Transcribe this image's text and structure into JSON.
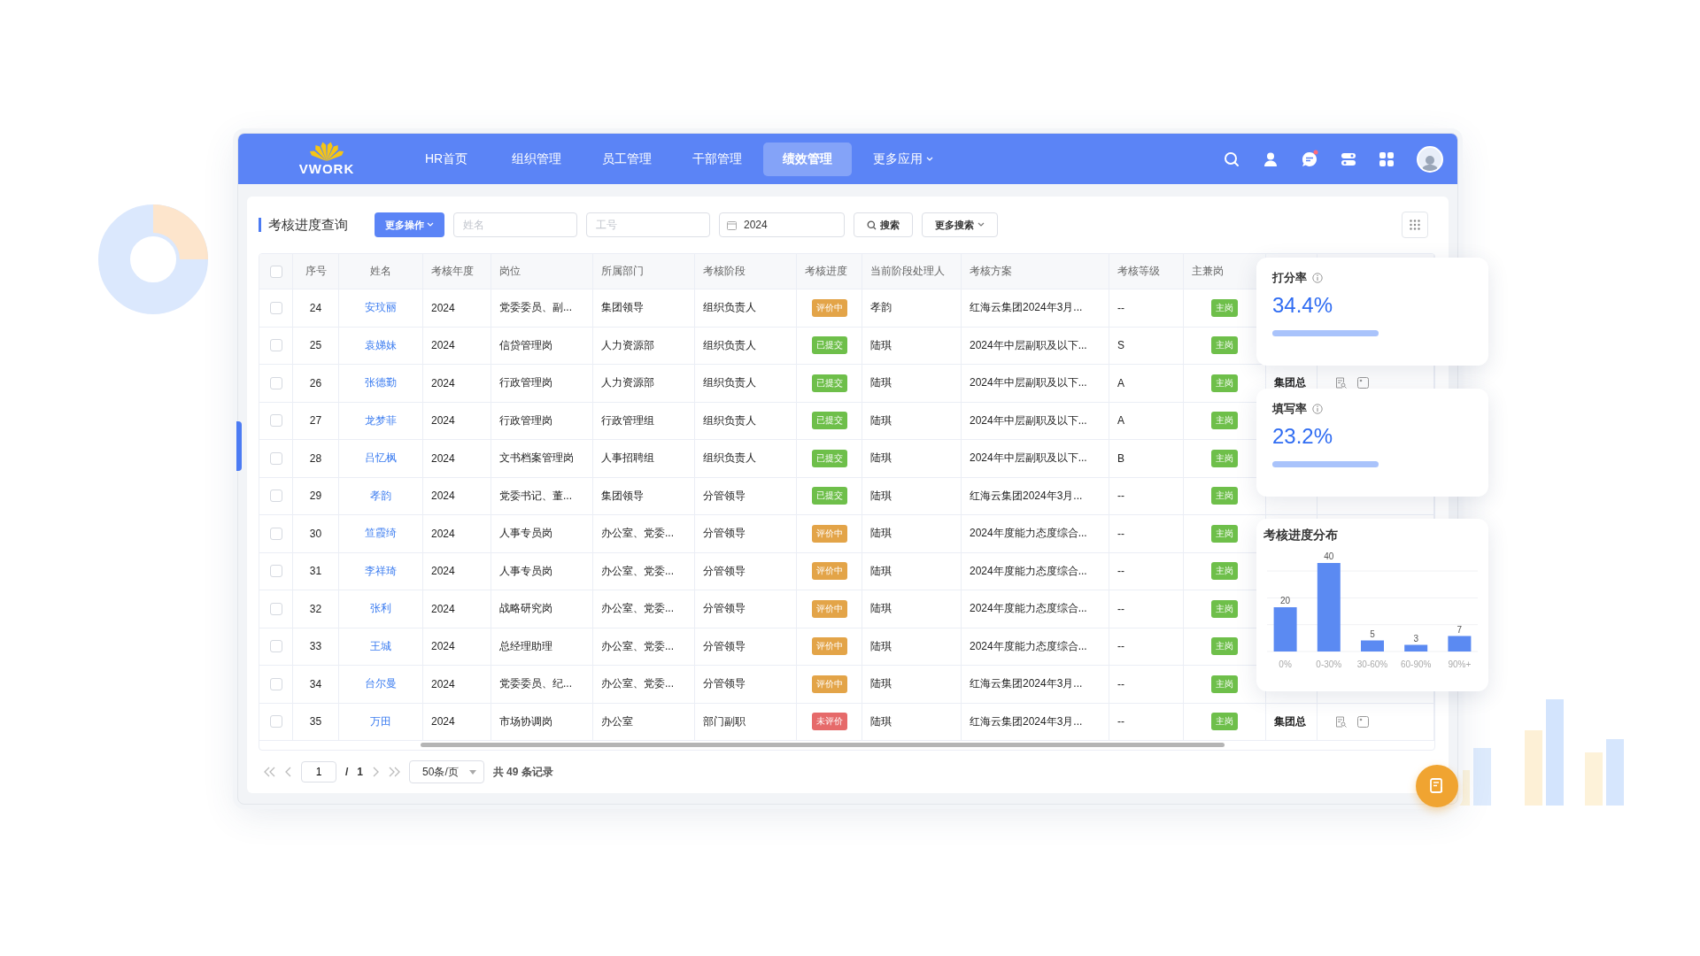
{
  "nav": {
    "logo": "VWORK",
    "items": [
      {
        "label": "HR首页",
        "selected": false
      },
      {
        "label": "组织管理",
        "selected": false
      },
      {
        "label": "员工管理",
        "selected": false
      },
      {
        "label": "干部管理",
        "selected": false
      },
      {
        "label": "绩效管理",
        "selected": true
      },
      {
        "label": "更多应用",
        "selected": false,
        "dropdown": true
      }
    ],
    "chat_unread": true
  },
  "toolbar": {
    "title": "考核进度查询",
    "more_actions": "更多操作",
    "name_field": {
      "placeholder": "姓名"
    },
    "id_field": {
      "placeholder": "工号"
    },
    "year_field": {
      "value": "2024"
    },
    "search": "搜索",
    "more_search": "更多搜索"
  },
  "table": {
    "header_checked": false,
    "columns": [
      "序号",
      "姓名",
      "考核年度",
      "岗位",
      "所属部门",
      "考核阶段",
      "考核进度",
      "当前阶段处理人",
      "考核方案",
      "考核等级",
      "主兼岗"
    ],
    "rows": [
      {
        "checked": false,
        "no": "24",
        "name": "安玟丽",
        "year": "2024",
        "post": "党委委员、副...",
        "dept": "集团领导",
        "stage": "组织负责人",
        "progress": {
          "text": "评价中",
          "color": "#e3a448"
        },
        "handler": "孝韵",
        "plan": "红海云集团2024年3月...",
        "grade": "--",
        "post_type": "主岗"
      },
      {
        "checked": false,
        "no": "25",
        "name": "袁娣妹",
        "year": "2024",
        "post": "信贷管理岗",
        "dept": "人力资源部",
        "stage": "组织负责人",
        "progress": {
          "text": "已提交",
          "color": "#6ebf4a"
        },
        "handler": "陆琪",
        "plan": "2024年中层副职及以下...",
        "grade": "S",
        "post_type": "主岗"
      },
      {
        "checked": false,
        "no": "26",
        "name": "张德勤",
        "year": "2024",
        "post": "行政管理岗",
        "dept": "人力资源部",
        "stage": "组织负责人",
        "progress": {
          "text": "已提交",
          "color": "#6ebf4a"
        },
        "handler": "陆琪",
        "plan": "2024年中层副职及以下...",
        "grade": "A",
        "post_type": "主岗",
        "column_12": "集团总"
      },
      {
        "checked": false,
        "no": "27",
        "name": "龙梦菲",
        "year": "2024",
        "post": "行政管理岗",
        "dept": "行政管理组",
        "stage": "组织负责人",
        "progress": {
          "text": "已提交",
          "color": "#6ebf4a"
        },
        "handler": "陆琪",
        "plan": "2024年中层副职及以下...",
        "grade": "A",
        "post_type": "主岗"
      },
      {
        "checked": false,
        "no": "28",
        "name": "吕忆枫",
        "year": "2024",
        "post": "文书档案管理岗",
        "dept": "人事招聘组",
        "stage": "组织负责人",
        "progress": {
          "text": "已提交",
          "color": "#6ebf4a"
        },
        "handler": "陆琪",
        "plan": "2024年中层副职及以下...",
        "grade": "B",
        "post_type": "主岗"
      },
      {
        "checked": false,
        "no": "29",
        "name": "孝韵",
        "year": "2024",
        "post": "党委书记、董...",
        "dept": "集团领导",
        "stage": "分管领导",
        "progress": {
          "text": "已提交",
          "color": "#6ebf4a"
        },
        "handler": "陆琪",
        "plan": "红海云集团2024年3月...",
        "grade": "--",
        "post_type": "主岗"
      },
      {
        "checked": false,
        "no": "30",
        "name": "笪霞绮",
        "year": "2024",
        "post": "人事专员岗",
        "dept": "办公室、党委...",
        "stage": "分管领导",
        "progress": {
          "text": "评价中",
          "color": "#e3a448"
        },
        "handler": "陆琪",
        "plan": "2024年度能力态度综合...",
        "grade": "--",
        "post_type": "主岗"
      },
      {
        "checked": false,
        "no": "31",
        "name": "李祥琦",
        "year": "2024",
        "post": "人事专员岗",
        "dept": "办公室、党委...",
        "stage": "分管领导",
        "progress": {
          "text": "评价中",
          "color": "#e3a448"
        },
        "handler": "陆琪",
        "plan": "2024年度能力态度综合...",
        "grade": "--",
        "post_type": "主岗"
      },
      {
        "checked": false,
        "no": "32",
        "name": "张利",
        "year": "2024",
        "post": "战略研究岗",
        "dept": "办公室、党委...",
        "stage": "分管领导",
        "progress": {
          "text": "评价中",
          "color": "#e3a448"
        },
        "handler": "陆琪",
        "plan": "2024年度能力态度综合...",
        "grade": "--",
        "post_type": "主岗"
      },
      {
        "checked": false,
        "no": "33",
        "name": "王城",
        "year": "2024",
        "post": "总经理助理",
        "dept": "办公室、党委...",
        "stage": "分管领导",
        "progress": {
          "text": "评价中",
          "color": "#e3a448"
        },
        "handler": "陆琪",
        "plan": "2024年度能力态度综合...",
        "grade": "--",
        "post_type": "主岗"
      },
      {
        "checked": false,
        "no": "34",
        "name": "台尔曼",
        "year": "2024",
        "post": "党委委员、纪...",
        "dept": "办公室、党委...",
        "stage": "分管领导",
        "progress": {
          "text": "评价中",
          "color": "#e3a448"
        },
        "handler": "陆琪",
        "plan": "红海云集团2024年3月...",
        "grade": "--",
        "post_type": "主岗"
      },
      {
        "checked": false,
        "no": "35",
        "name": "万田",
        "year": "2024",
        "post": "市场协调岗",
        "dept": "办公室",
        "stage": "部门副职",
        "progress": {
          "text": "未评价",
          "color": "#e66a6a"
        },
        "handler": "陆琪",
        "plan": "红海云集团2024年3月...",
        "grade": "--",
        "post_type": "主岗",
        "column_12": "集团总"
      }
    ]
  },
  "pagination": {
    "page": "1",
    "separator": "/",
    "total_pages": "1",
    "page_size": "50条/页",
    "total": "共 49 条记录"
  },
  "stats": [
    {
      "label": "打分率",
      "value": "34.4%"
    },
    {
      "label": "填写率",
      "value": "23.2%"
    }
  ],
  "distribution": {
    "title": "考核进度分布",
    "chart_data": {
      "type": "bar",
      "categories": [
        "0%",
        "0-30%",
        "30-60%",
        "60-90%",
        "90%+"
      ],
      "values": [
        20,
        40,
        5,
        3,
        7
      ],
      "data_labels": true
    }
  }
}
